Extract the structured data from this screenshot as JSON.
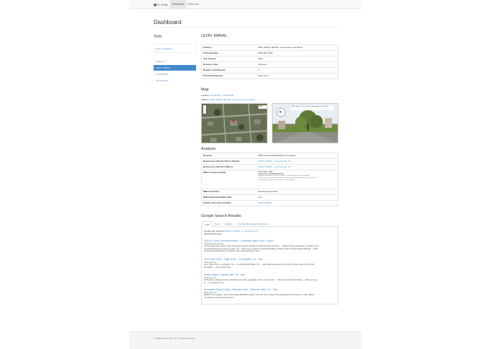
{
  "app": {
    "brand": "ID Verify",
    "nav_tabs": [
      "Dashboard",
      "Reference"
    ]
  },
  "page_title": "Dashboard",
  "sidebar": {
    "title": "Tools",
    "new_investigation": "New Investigation",
    "items": [
      "Apple Inc.",
      "LEON, MARAL",
      "ACCESS INC",
      "John Renard"
    ]
  },
  "business": {
    "name": "LEON, MARAL",
    "rows": [
      {
        "k": "Address",
        "v": "2906 JANET LEE DR, La Crescenta, CA 91214"
      },
      {
        "k": "Phone Number",
        "v": "(818) 957-4059"
      },
      {
        "k": "Year Started",
        "v": "2005"
      },
      {
        "k": "Business Type",
        "v": "Unknown"
      },
      {
        "k": "Number of Employees",
        "v": "0"
      },
      {
        "k": "Principal Employee",
        "v": "Maral Leon"
      }
    ]
  },
  "map": {
    "title": "Map",
    "location_label": "Location:",
    "location_value": "34.234179, -118.237008",
    "address_label": "Address:",
    "address_value": "2906 JANET LEE DR, La Crescenta, CA 91214",
    "map_button": "Map",
    "street_caption": "2906 Janet Lee Dr, La Crescenta-Montrose, California"
  },
  "analysis": {
    "title": "Analysis",
    "rows": [
      {
        "k": "Revenue",
        "v": "$500 Thousand ($100000 per employee"
      },
      {
        "k": "Businesses with this Phone Number",
        "v": "LEON, MARAL - La Crescenta, CA",
        "link": true
      },
      {
        "k": "Businesses with this Address",
        "v": "LEON, MARAL - La Crescenta, CA",
        "link": true
      },
      {
        "k": "DNB Commercial Risk",
        "v": "Credit Score: 528"
      },
      {
        "k": "DNB Fraud Risk",
        "v": "Reduced Fraud Risk"
      },
      {
        "k": "DNB Financial Stability Risk",
        "v": "Low"
      },
      {
        "k": "Entities with same principle",
        "v": "LEON, MARAL",
        "link": true
      }
    ],
    "risk_extra": [
      "Assessment: MODERATE RISK",
      "Payment information on file was indicative of slow payment(s) not regarded",
      "excessively. Or of mixed assessment indicative slow payment(s) but present in record",
      "of slow history. Limited or insignificant in the D&B files."
    ]
  },
  "search": {
    "title": "Google Search Results",
    "tabs": [
      "Web",
      "News",
      "Patents",
      "Principal Employee (Maral Leon)"
    ],
    "intro_prefix": "Google web results for",
    "intro_query": "LEON, MARAL, La Crescenta, CA",
    "intro_count": "About 286 Results",
    "results": [
      {
        "title": "2013 CV Town Councilmembers - Crescenta Valley Town Council",
        "url": "www.thecvcouncil.com",
        "snip": [
          "Cheryl Davis was raised in San Jose and moved to Southern California while at UCLA. ... Daniel Cheung has been a resident of La",
          "Crescenta during the past ten years. He ... Harry Leon moved to Crescenta Valley in 2003 to have his kids attend National ... Harry",
          "and his wife Maral have two children who attended Monte Vista ..."
        ]
      },
      {
        "title": "Leo's Taco Truck - Eagle Rock - Los Angeles, CA - Yelp",
        "url": "www.yelp.com",
        "snip": [
          "Leo's Taco Truck, Los Angeles, CA ... La Canada Flintridge, CA ... I also want everyone to know that I drove a taco from Emilio",
          "and Maral ... except that's how ..."
        ]
      },
      {
        "title": "Maral Cuisine - Agoura Hills, CA - Yelp",
        "url": "www.yelp.com",
        "snip": [
          "26 Reviews of Maral Cuisine \"Delicious Armenian especially on the Lunch menu\" ... 28 reviews for Maral Cuisine ... Photo of Leon",
          "H. ... Los Angeles, CA."
        ]
      },
      {
        "title": "Scheduled Glass Tinting - Sherman Oaks - Sherman Oaks, CA - Yelp",
        "url": "www.yelp.com",
        "snip": [
          "Maral V. Los Angeles, CA 3.0 star rating. 6/5/2013 1 photo. Not sure why I haven't complemented them sooner on Yelp. Within",
          "our family we have trusted our tint ..."
        ]
      }
    ]
  },
  "footer": "© 2013 Who Knows, Inc. All rights reserved."
}
